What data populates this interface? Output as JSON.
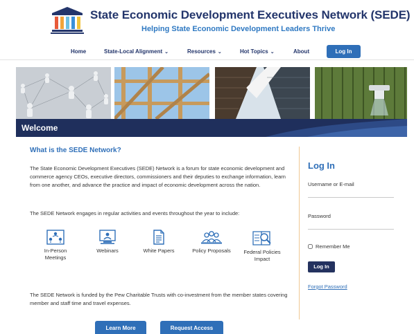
{
  "header": {
    "title": "State Economic Development Executives Network (SEDE)",
    "tagline": "Helping State Economic Development Leaders Thrive"
  },
  "nav": {
    "items": [
      {
        "label": "Home",
        "has_dropdown": false
      },
      {
        "label": "State-Local Alignment",
        "has_dropdown": true
      },
      {
        "label": "Resources",
        "has_dropdown": true
      },
      {
        "label": "Hot Topics",
        "has_dropdown": true
      },
      {
        "label": "About",
        "has_dropdown": false
      }
    ],
    "login_label": "Log In"
  },
  "banner": {
    "welcome": "Welcome"
  },
  "main": {
    "heading": "What is the SEDE Network?",
    "intro": "The State Economic Development Executives (SEDE) Network is a forum for state economic development and commerce agency CEOs, executive directors, commissioners and their deputies to exchange information, learn from one another, and advance the practice and impact of economic development across the nation.",
    "activities_intro": "The SEDE Network engages in regular activities and events throughout the year to include:",
    "activities": [
      {
        "label": "In-Person Meetings",
        "icon": "people-network-icon"
      },
      {
        "label": "Webinars",
        "icon": "webinar-icon"
      },
      {
        "label": "White Papers",
        "icon": "document-icon"
      },
      {
        "label": "Policy Proposals",
        "icon": "group-icon"
      },
      {
        "label": "Federal Policies Impact",
        "icon": "book-search-icon"
      }
    ],
    "funding": "The SEDE Network is funded by the Pew Charitable Trusts with co-investment from the member states covering member and staff time and travel expenses.",
    "learn_more": "Learn More",
    "request_access": "Request Access"
  },
  "login": {
    "title": "Log In",
    "username_label": "Username or E-mail",
    "password_label": "Password",
    "remember_label": "Remember Me",
    "submit_label": "Log In",
    "forgot_label": "Forgot Password"
  },
  "colors": {
    "navy": "#23356b",
    "blue": "#2f6fb8",
    "welcome_bar": "#1f2f5c",
    "divider": "#f0c893"
  }
}
